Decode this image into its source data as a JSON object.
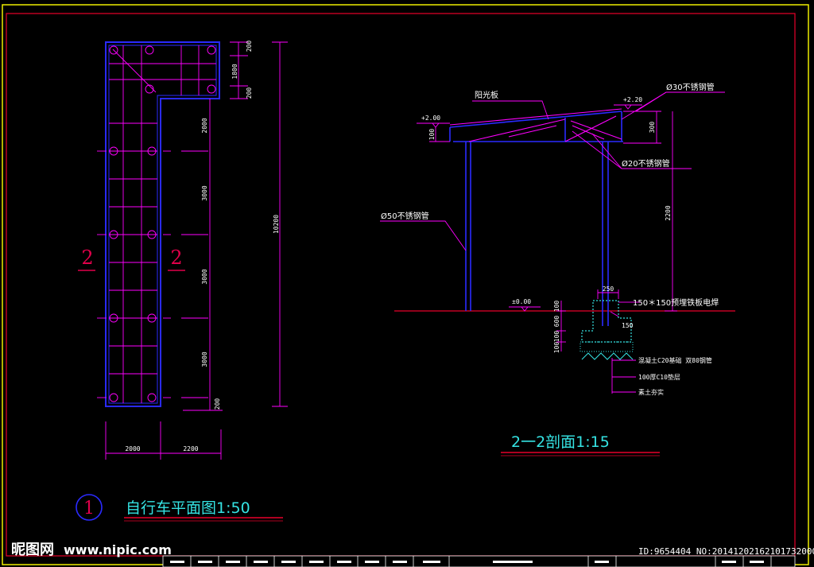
{
  "plan": {
    "title": "自行车平面图1:50",
    "detail_number": "1",
    "section_mark_left": "2",
    "section_mark_right": "2",
    "dims_right": [
      "200",
      "1800",
      "200",
      "2000",
      "3000",
      "3000",
      "3000",
      "200"
    ],
    "dim_overall": "10200",
    "dims_bottom": [
      "2000",
      "2200"
    ]
  },
  "section": {
    "title": "2一2剖面1:15",
    "labels": {
      "roof_panel": "阳光板",
      "tube_30": "Ø30不锈钢管",
      "tube_20": "Ø20不锈钢管",
      "tube_50": "Ø50不锈钢管",
      "anchor_plate": "150＊150预埋铁板电焊",
      "foundation_1": "混凝土C20基础 双80钢管",
      "foundation_2": "100厚C10垫层",
      "foundation_3": "素土夯实"
    },
    "elevations": {
      "left_top": "+2.00",
      "right_top": "+2.20",
      "ground": "±0.00"
    },
    "dims": {
      "roof_height": "300",
      "eave_height": "100",
      "column_height": "2200",
      "footing_width": "250",
      "footing_dims": [
        "100",
        "600",
        "100",
        "100"
      ],
      "anchor_offset": "150"
    }
  },
  "watermark": {
    "brand": "昵图网",
    "site": "www.nipic.com",
    "id_text": "ID:9654404 NO:20141202162101732000"
  },
  "colors": {
    "frame": "#ffff00",
    "structure": "#2a2aff",
    "dimension": "#ff00ff",
    "title": "#35e3e3",
    "section_mark": "#e0004a"
  }
}
